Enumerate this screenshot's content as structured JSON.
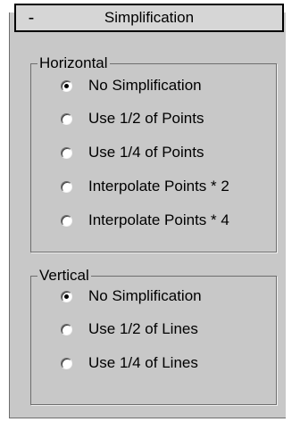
{
  "rollout": {
    "toggle_symbol": "-",
    "title": "Simplification"
  },
  "horizontal": {
    "legend": "Horizontal",
    "options": [
      {
        "label": "No Simplification",
        "checked": true
      },
      {
        "label": "Use 1/2 of Points",
        "checked": false
      },
      {
        "label": "Use 1/4 of Points",
        "checked": false
      },
      {
        "label": "Interpolate Points * 2",
        "checked": false
      },
      {
        "label": "Interpolate Points * 4",
        "checked": false
      }
    ]
  },
  "vertical": {
    "legend": "Vertical",
    "options": [
      {
        "label": "No Simplification",
        "checked": true
      },
      {
        "label": "Use 1/2 of Lines",
        "checked": false
      },
      {
        "label": "Use 1/4 of Lines",
        "checked": false
      }
    ]
  },
  "colors": {
    "panel_bg": "#c8c8c8",
    "header_bg": "#d6d6d6",
    "border_dark": "#6e6e6e"
  }
}
